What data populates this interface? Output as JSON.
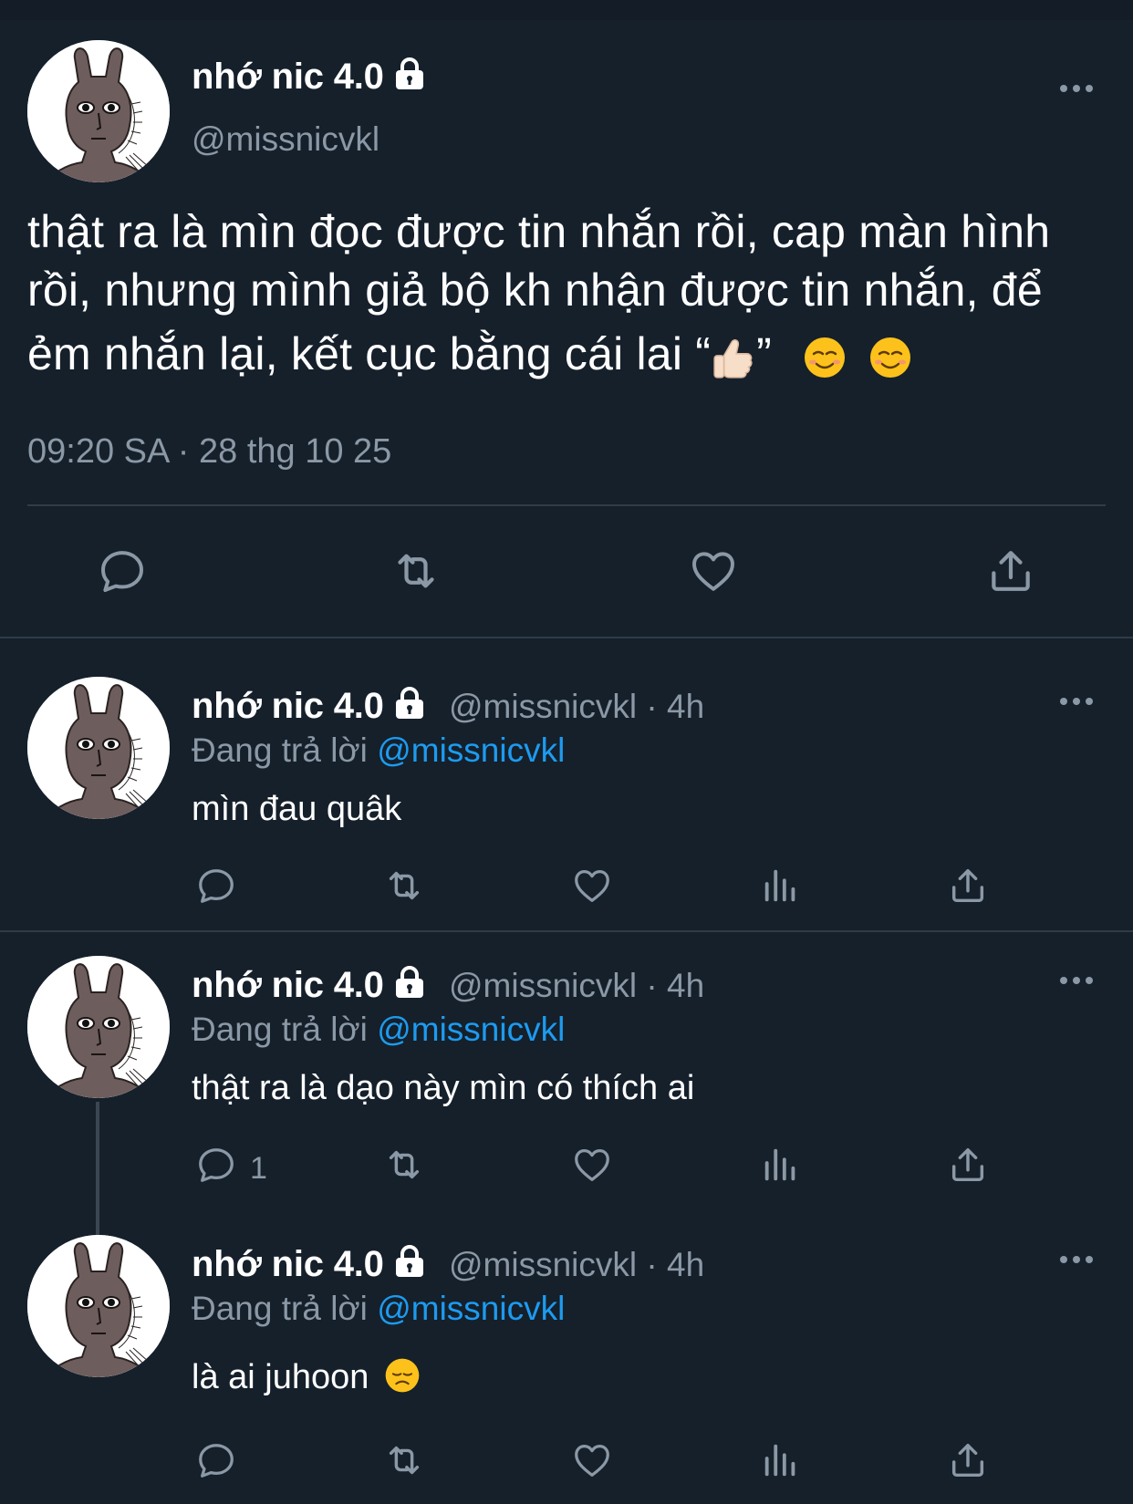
{
  "main_tweet": {
    "display_name": "nhớ nic 4.0",
    "handle": "@missnicvkl",
    "text_line1": "thật ra là mìn đọc được tin nhắn rồi, cap màn hình",
    "text_line2": "rồi, nhưng mình giả bộ kh nhận được tin nhắn, để",
    "text_line3_prefix": "ẻm nhắn lại, kết cục bằng cái lai “",
    "text_line3_suffix": "”",
    "timestamp": "09:20 SA · 28 thg 10 25",
    "emojis": [
      "thumbs-up",
      "smiling-face",
      "smiling-face"
    ]
  },
  "replies": [
    {
      "display_name": "nhớ nic 4.0",
      "handle_time": "@missnicvkl · 4h",
      "replying_prefix": "Đang trả lời ",
      "replying_to": "@missnicvkl",
      "text": "mìn đau quâk",
      "reply_count": ""
    },
    {
      "display_name": "nhớ nic 4.0",
      "handle_time": "@missnicvkl · 4h",
      "replying_prefix": "Đang trả lời ",
      "replying_to": "@missnicvkl",
      "text": "thật ra là dạo này mìn có thích ai",
      "reply_count": "1"
    },
    {
      "display_name": "nhớ nic 4.0",
      "handle_time": "@missnicvkl · 4h",
      "replying_prefix": "Đang trả lời ",
      "replying_to": "@missnicvkl",
      "text": "là ai juhoon",
      "emoji": "disappointed-face",
      "reply_count": ""
    }
  ],
  "colors": {
    "background": "#15202b",
    "text": "#ffffff",
    "secondary": "#8b98a5",
    "link": "#1d9bf0"
  },
  "icons": [
    "lock-icon",
    "reply-icon",
    "retweet-icon",
    "like-icon",
    "views-icon",
    "share-icon",
    "more-icon"
  ]
}
